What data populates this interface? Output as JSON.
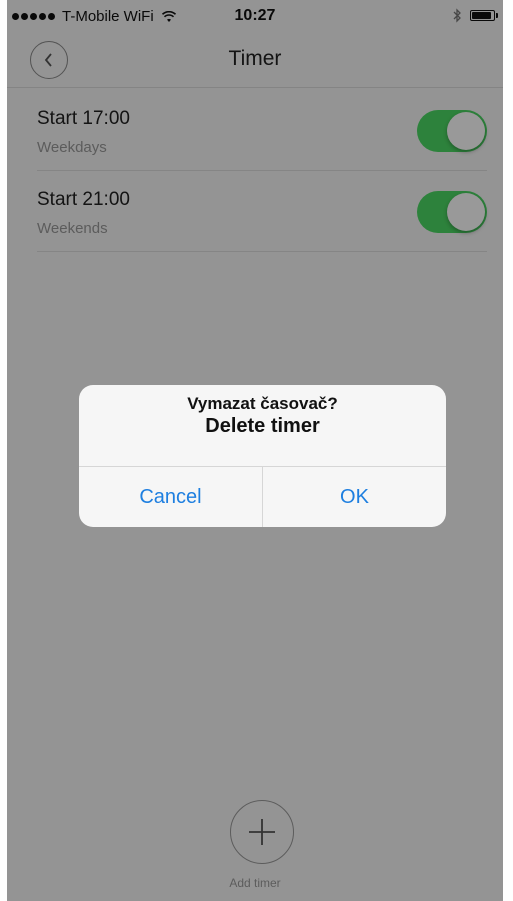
{
  "status_bar": {
    "carrier": "T-Mobile WiFi",
    "time": "10:27",
    "icons": [
      "signal-dots-icon",
      "wifi-icon",
      "bluetooth-icon",
      "battery-icon"
    ]
  },
  "nav": {
    "back_icon": "chevron-left-icon",
    "title": "Timer"
  },
  "timers": [
    {
      "title": "Start 17:00",
      "subtitle": "Weekdays",
      "enabled": true
    },
    {
      "title": "Start 21:00",
      "subtitle": "Weekends",
      "enabled": true
    }
  ],
  "add_timer": {
    "icon": "plus-icon",
    "label": "Add timer"
  },
  "alert": {
    "title": "Vymazat časovač?",
    "message": "Delete timer",
    "cancel_label": "Cancel",
    "ok_label": "OK"
  },
  "colors": {
    "toggle_on": "#4cd964",
    "alert_action": "#1e7fe0"
  }
}
